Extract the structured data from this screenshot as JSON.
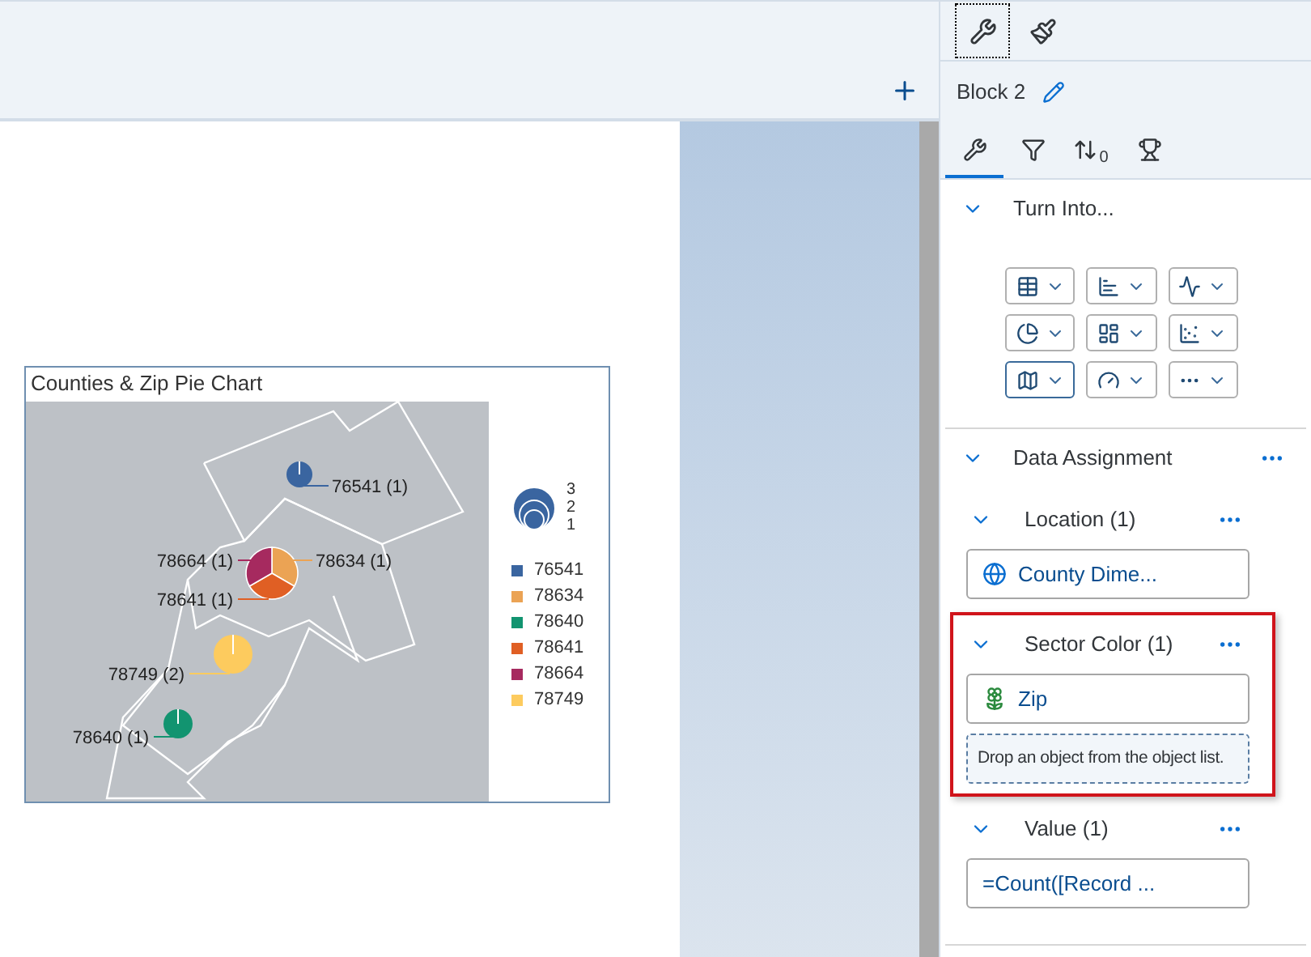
{
  "panel_tabs": [
    {
      "kind": "build",
      "selected": true
    },
    {
      "kind": "format",
      "selected": false
    }
  ],
  "block": {
    "title": "Block 2"
  },
  "sub_tabs": [
    {
      "kind": "build",
      "selected": true
    },
    {
      "kind": "filter",
      "selected": false
    },
    {
      "kind": "sort",
      "selected": false,
      "badge": "0"
    },
    {
      "kind": "ranking",
      "selected": false
    }
  ],
  "turn_into": {
    "title": "Turn Into...",
    "expanded": true,
    "chart_types": [
      {
        "kind": "table",
        "selected": false
      },
      {
        "kind": "bar",
        "selected": false
      },
      {
        "kind": "line",
        "selected": false
      },
      {
        "kind": "pie",
        "selected": false
      },
      {
        "kind": "treemap",
        "selected": false
      },
      {
        "kind": "scatter",
        "selected": false
      },
      {
        "kind": "map",
        "selected": true
      },
      {
        "kind": "gauge",
        "selected": false
      },
      {
        "kind": "more",
        "selected": false
      }
    ]
  },
  "data_assignment": {
    "title": "Data Assignment",
    "expanded": true,
    "groups": [
      {
        "title": "Location (1)",
        "highlighted": false,
        "items": [
          {
            "kind": "geo",
            "text": "County Dime..."
          }
        ]
      },
      {
        "title": "Sector Color (1)",
        "highlighted": true,
        "items": [
          {
            "kind": "dimension",
            "text": "Zip"
          },
          {
            "kind": "drop",
            "text": "Drop an object from the object list."
          }
        ]
      },
      {
        "title": "Value (1)",
        "highlighted": false,
        "items": [
          {
            "kind": "formula",
            "text": "=Count([Record ..."
          }
        ]
      }
    ]
  },
  "chart": {
    "title": "Counties & Zip Pie Chart",
    "pies": [
      {
        "slices": [
          {
            "color": "#3a65a0",
            "label": "76541 (1)"
          }
        ]
      },
      {
        "slices": [
          {
            "color": "#eba354",
            "label": "78634 (1)"
          },
          {
            "color": "#e05f24",
            "label": "78641 (1)"
          },
          {
            "color": "#a62a5f",
            "label": "78664 (1)"
          }
        ]
      },
      {
        "slices": [
          {
            "color": "#fdcb5e",
            "label": "78749 (2)"
          }
        ]
      },
      {
        "slices": [
          {
            "color": "#129470",
            "label": "78640 (1)"
          }
        ]
      }
    ],
    "size_legend": [
      "3",
      "2",
      "1"
    ],
    "legend": [
      {
        "label": "76541",
        "color": "#3a65a0"
      },
      {
        "label": "78634",
        "color": "#eba354"
      },
      {
        "label": "78640",
        "color": "#129470"
      },
      {
        "label": "78641",
        "color": "#e05f24"
      },
      {
        "label": "78664",
        "color": "#a62a5f"
      },
      {
        "label": "78749",
        "color": "#fdcb5e"
      }
    ]
  }
}
